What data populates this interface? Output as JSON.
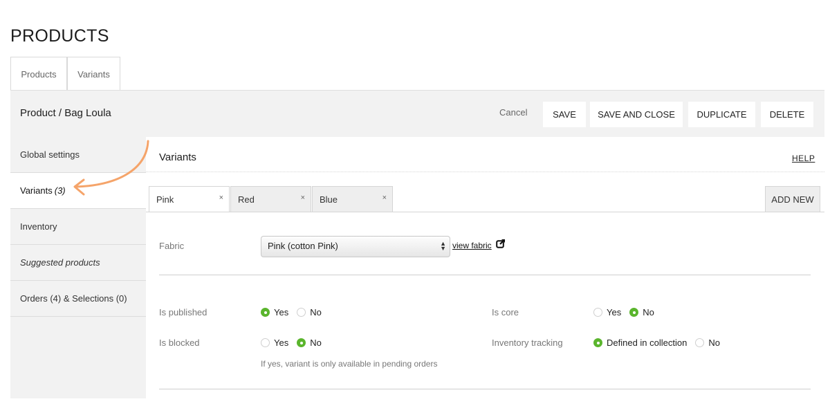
{
  "page": {
    "title": "PRODUCTS"
  },
  "top_tabs": [
    {
      "label": "Products"
    },
    {
      "label": "Variants"
    }
  ],
  "header": {
    "breadcrumb": "Product / Bag Loula",
    "cancel_label": "Cancel",
    "save_label": "SAVE",
    "save_close_label": "SAVE AND CLOSE",
    "duplicate_label": "DUPLICATE",
    "delete_label": "DELETE"
  },
  "sidebar": {
    "items": [
      {
        "label": "Global settings"
      },
      {
        "label": "Variants",
        "count": "(3)",
        "active": true
      },
      {
        "label": "Inventory"
      },
      {
        "label": "Suggested products"
      },
      {
        "label": "Orders (4) & Selections (0)"
      }
    ]
  },
  "main": {
    "section_title": "Variants",
    "help_label": "HELP",
    "variant_tabs": [
      {
        "label": "Pink",
        "close": "×",
        "active": true
      },
      {
        "label": "Red",
        "close": "×"
      },
      {
        "label": "Blue",
        "close": "×"
      }
    ],
    "add_new_label": "ADD NEW",
    "fabric": {
      "label": "Fabric",
      "selected": "Pink (cotton Pink)",
      "view_link": "view fabric"
    },
    "is_published": {
      "label": "Is published",
      "yes": "Yes",
      "no": "No",
      "value": "Yes"
    },
    "is_core": {
      "label": "Is core",
      "yes": "Yes",
      "no": "No",
      "value": "No"
    },
    "is_blocked": {
      "label": "Is blocked",
      "yes": "Yes",
      "no": "No",
      "value": "No",
      "hint": "If yes, variant is only available in pending orders"
    },
    "inventory_tracking": {
      "label": "Inventory tracking",
      "option1": "Defined in collection",
      "option2": "No",
      "value": "Defined in collection"
    }
  },
  "colors": {
    "accent_green": "#5ab52d",
    "annotation_orange": "#f5a46a",
    "panel_gray": "#f2f2f2"
  }
}
